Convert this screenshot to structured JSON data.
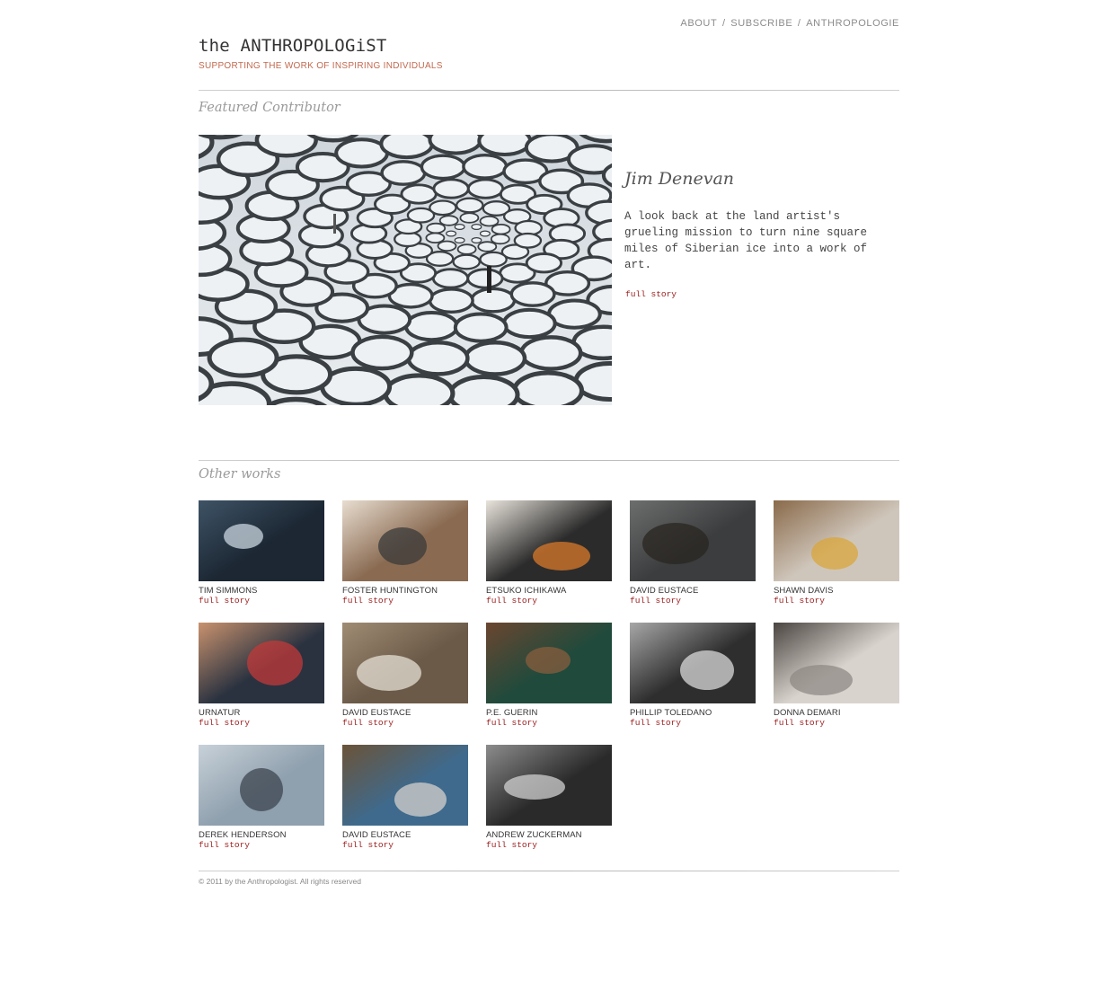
{
  "nav": {
    "items": [
      {
        "label": "ABOUT"
      },
      {
        "label": "SUBSCRIBE"
      },
      {
        "label": "ANTHROPOLOGIE"
      }
    ],
    "separator": " / "
  },
  "brand": {
    "title": "the ANTHROPOLOGiST",
    "tagline": "SUPPORTING THE WORK OF INSPIRING INDIVIDUALS"
  },
  "featured": {
    "heading": "Featured Contributor",
    "name": "Jim Denevan",
    "description": "A look back at the land artist's grueling mission to turn nine square miles of Siberian ice into a work of art.",
    "link": "full story",
    "image_icon": "snow-circles-photo"
  },
  "other": {
    "heading": "Other works",
    "items": [
      {
        "name": "TIM SIMMONS",
        "link": "full story",
        "palette": [
          "#1c2733",
          "#3e5366",
          "#c9d6df"
        ]
      },
      {
        "name": "FOSTER HUNTINGTON",
        "link": "full story",
        "palette": [
          "#8a6b52",
          "#e8ddd0",
          "#3a3a3a"
        ]
      },
      {
        "name": "ETSUKO ICHIKAWA",
        "link": "full story",
        "palette": [
          "#2b2b2b",
          "#e9e4dc",
          "#d97a2b"
        ]
      },
      {
        "name": "DAVID EUSTACE",
        "link": "full story",
        "palette": [
          "#3b3d3e",
          "#6c6e6e",
          "#2a2620"
        ]
      },
      {
        "name": "SHAWN DAVIS",
        "link": "full story",
        "palette": [
          "#cfc6bb",
          "#8a6a4a",
          "#d9a63b"
        ]
      },
      {
        "name": "URNATUR",
        "link": "full story",
        "palette": [
          "#2a3240",
          "#c9926e",
          "#c23a3a"
        ]
      },
      {
        "name": "DAVID EUSTACE",
        "link": "full story",
        "palette": [
          "#6b5a48",
          "#a08c74",
          "#e6e0d6"
        ]
      },
      {
        "name": "P.E. GUERIN",
        "link": "full story",
        "palette": [
          "#1f4a3c",
          "#6b4630",
          "#8a5e3e"
        ]
      },
      {
        "name": "PHILLIP TOLEDANO",
        "link": "full story",
        "palette": [
          "#2e2e2e",
          "#a7a7a7",
          "#d9d9d9"
        ]
      },
      {
        "name": "DONNA DEMARI",
        "link": "full story",
        "palette": [
          "#d8d3cd",
          "#4a4540",
          "#8f8a84"
        ]
      },
      {
        "name": "DEREK HENDERSON",
        "link": "full story",
        "palette": [
          "#8fa0ae",
          "#c8d1d8",
          "#3d4650"
        ]
      },
      {
        "name": "DAVID EUSTACE",
        "link": "full story",
        "palette": [
          "#3f6a8d",
          "#6b5338",
          "#d6d2cc"
        ]
      },
      {
        "name": "ANDREW ZUCKERMAN",
        "link": "full story",
        "palette": [
          "#2a2a2a",
          "#8c8c8c",
          "#d0d0d0"
        ]
      }
    ]
  },
  "footer": {
    "copyright": "© 2011 by the Anthropologist. All rights reserved"
  },
  "colors": {
    "accent": "#c2694f",
    "link": "#9b1c1c",
    "heading": "#9a9a9a"
  }
}
